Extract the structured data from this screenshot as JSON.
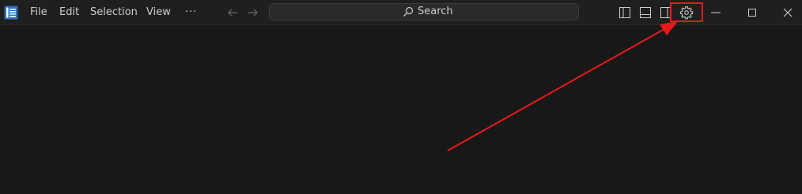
{
  "menu": {
    "file": "File",
    "edit": "Edit",
    "selection": "Selection",
    "view": "View",
    "more": "···"
  },
  "search": {
    "label": "Search"
  },
  "colors": {
    "titlebar_bg": "#1f1f1f",
    "editor_bg": "#181818",
    "text": "#cccccc",
    "annotation_red": "#e8191a",
    "app_icon_blue": "#3c8fd8"
  },
  "icons": {
    "app": "vscode-app-icon",
    "back": "arrow-left-icon",
    "forward": "arrow-right-icon",
    "search": "search-icon",
    "toggle_primary_sidebar": "layout-sidebar-left-icon",
    "toggle_panel": "layout-panel-icon",
    "toggle_secondary_sidebar": "layout-sidebar-right-icon",
    "settings": "gear-icon",
    "minimize": "minimize-icon",
    "maximize": "maximize-icon",
    "close": "close-icon"
  }
}
